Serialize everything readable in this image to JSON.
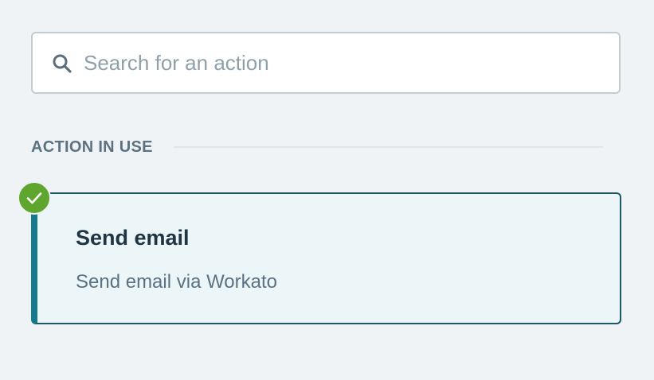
{
  "search": {
    "placeholder": "Search for an action",
    "value": "",
    "icon": "search-icon"
  },
  "section": {
    "title": "ACTION IN USE"
  },
  "action": {
    "title": "Send email",
    "description": "Send email via Workato",
    "status_icon": "check-circle-icon",
    "selected": true
  },
  "colors": {
    "background": "#f0f3f5",
    "card_background": "#ecf5f8",
    "card_accent": "#157a8c",
    "card_border": "#1b5866",
    "success_green": "#5ea62e",
    "muted_text": "#5b7282",
    "dark_text": "#1f3543"
  }
}
